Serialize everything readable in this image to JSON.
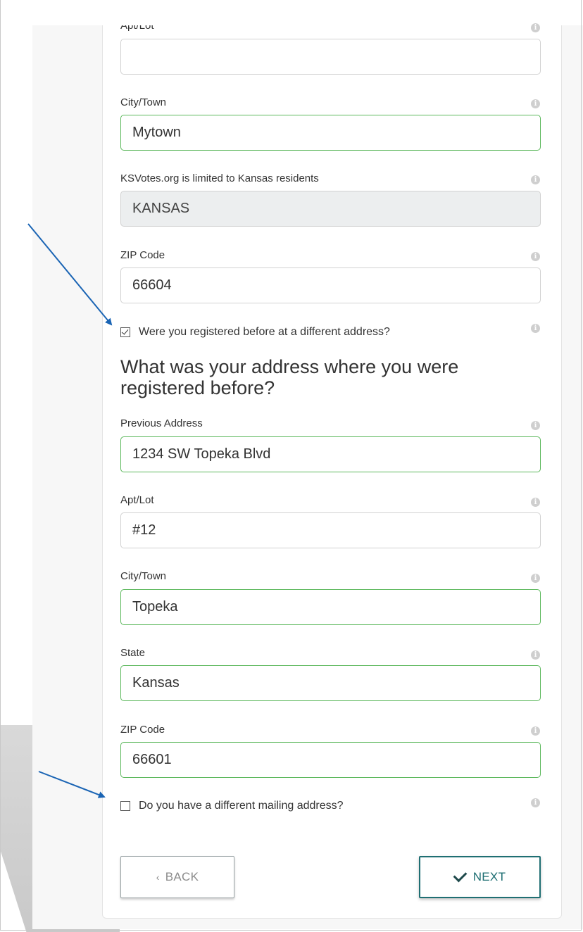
{
  "top_cut_label": "Apt/Lot",
  "current": {
    "city_label": "City/Town",
    "city_value": "Mytown",
    "state_label": "KSVotes.org is limited to Kansas residents",
    "state_value": "KANSAS",
    "zip_label": "ZIP Code",
    "zip_value": "66604"
  },
  "prev_registered_checkbox": "Were you registered before at a different address?",
  "previous": {
    "heading": "What was your address where you were registered before?",
    "address_label": "Previous Address",
    "address_value": "1234 SW Topeka Blvd",
    "apt_label": "Apt/Lot",
    "apt_value": "#12",
    "city_label": "City/Town",
    "city_value": "Topeka",
    "state_label": "State",
    "state_value": "Kansas",
    "zip_label": "ZIP Code",
    "zip_value": "66601"
  },
  "mailing_checkbox": "Do you have a different mailing address?",
  "buttons": {
    "back": "BACK",
    "next": "NEXT"
  },
  "info_glyph": "i",
  "colors": {
    "valid_border": "#5cb85c",
    "next_accent": "#1f6f73",
    "annotation_arrow": "#1a64b4"
  }
}
